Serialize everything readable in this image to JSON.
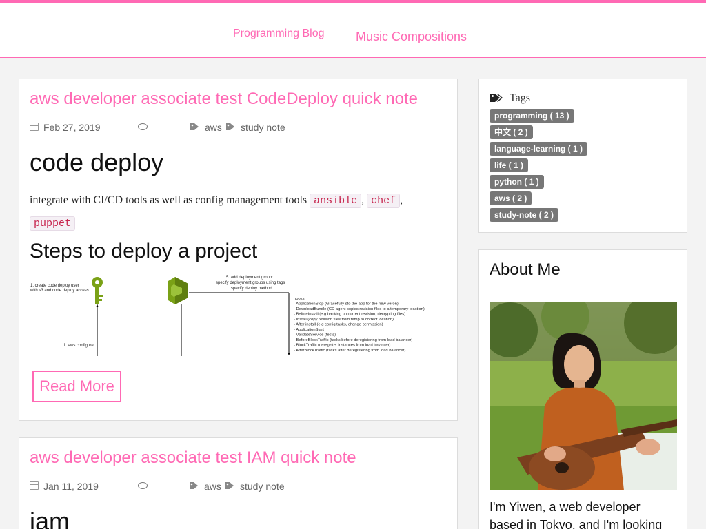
{
  "nav": {
    "links": [
      {
        "label": "Programming Blog"
      },
      {
        "label": "Music Compositions"
      }
    ]
  },
  "posts": [
    {
      "title": "aws developer associate test CodeDeploy quick note",
      "date": "Feb 27, 2019",
      "tags": [
        "aws",
        "study note"
      ],
      "heading1": "code deploy",
      "paragraph_text": "integrate with CI/CD tools as well as config management tools",
      "code_items": [
        "ansible",
        "chef",
        "puppet"
      ],
      "heading2": "Steps to deploy a project",
      "diagram": {
        "step1": [
          "1. create code deploy user",
          "with s3 and code deploy access"
        ],
        "step_configure": "1. aws configure",
        "step5": [
          "5. add deployment group:",
          "specify deployment groups using tags",
          "specify deploy method"
        ],
        "hooks": [
          "hooks:",
          "- ApplicationStop (Gracefully sto the app for the new veron)",
          "- DownloadBundle (CD agent copies revision files to a temporary location)",
          "- BeforeInstall (e.g backing up current revision, decrypting files)",
          "- Install (copy revision files from temp to correct location)",
          "- After install (e.g config tasks, change permission)",
          "- ApplicationStart",
          "- ValidateService (tests)",
          "- BeforeBlockTraffic (tasks before deregistering from load balancer)",
          "- BlockTraffic (deregister instances from load balancer)",
          "- AfterBlockTraffic (tasks after deregistering from load balancer)"
        ]
      },
      "read_more": "Read More"
    },
    {
      "title": "aws developer associate test IAM quick note",
      "date": "Jan 11, 2019",
      "tags": [
        "aws",
        "study note"
      ],
      "heading1": "iam"
    }
  ],
  "sidebar": {
    "tags_title": "Tags",
    "tags": [
      "programming ( 13 )",
      "中文 ( 2 )",
      "language-learning ( 1 )",
      "life ( 1 )",
      "python ( 1 )",
      "aws ( 2 )",
      "study-note ( 2 )"
    ],
    "about_title": "About Me",
    "about_text": "I'm Yiwen, a web developer based in Tokyo, and I'm looking"
  },
  "colors": {
    "accent": "#ff69b4",
    "tag_pill": "#777777",
    "code_text": "#c7254e",
    "aws_green": "#7aa116"
  },
  "icons": [
    "calendar-icon",
    "comment-icon",
    "tag-icon",
    "tags-icon",
    "iam-key-icon",
    "codedeploy-icon"
  ]
}
